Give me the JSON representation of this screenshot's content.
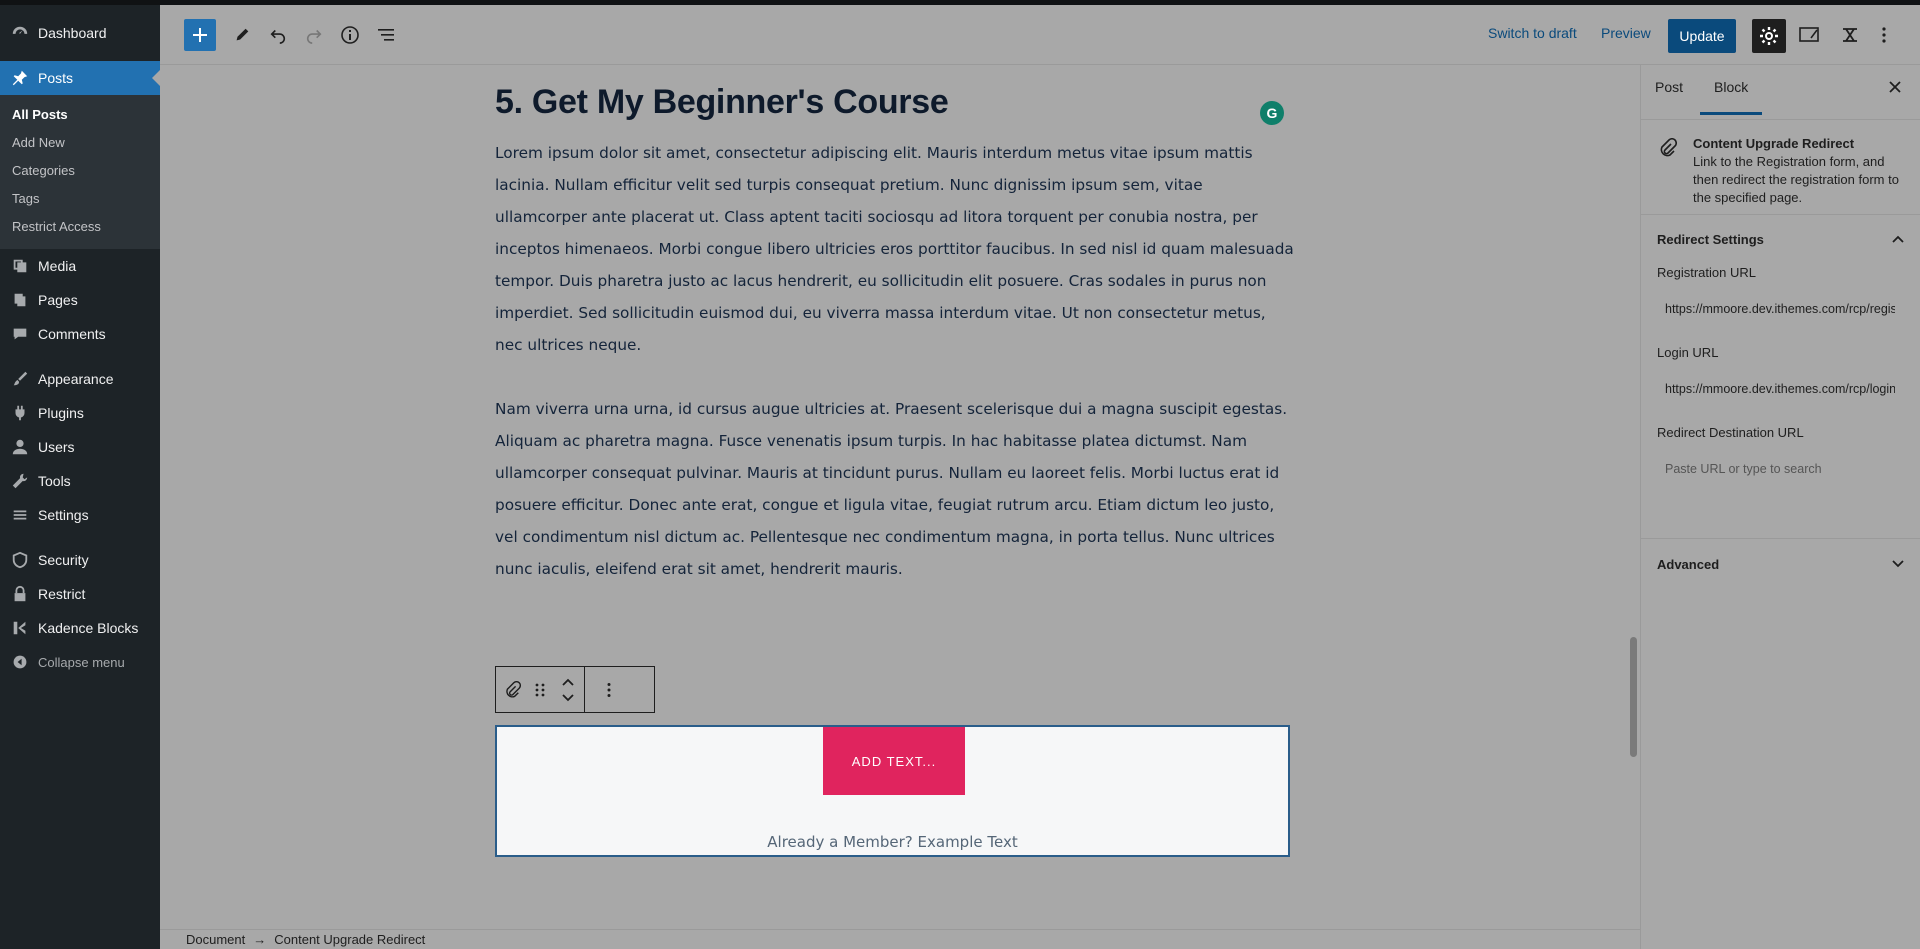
{
  "admin_menu": {
    "dashboard": "Dashboard",
    "posts": "Posts",
    "posts_sub": [
      "All Posts",
      "Add New",
      "Categories",
      "Tags",
      "Restrict Access"
    ],
    "media": "Media",
    "pages": "Pages",
    "comments": "Comments",
    "appearance": "Appearance",
    "plugins": "Plugins",
    "users": "Users",
    "tools": "Tools",
    "settings": "Settings",
    "security": "Security",
    "restrict": "Restrict",
    "kadence": "Kadence Blocks",
    "collapse": "Collapse menu"
  },
  "toolbar": {
    "switch_to_draft": "Switch to draft",
    "preview": "Preview",
    "update": "Update"
  },
  "content": {
    "heading": "5. Get My Beginner's Course",
    "paragraph1": "Lorem ipsum dolor sit amet, consectetur adipiscing elit. Mauris interdum metus vitae ipsum mattis lacinia. Nullam efficitur velit sed turpis consequat pretium. Nunc dignissim ipsum sem, vitae ullamcorper ante placerat ut. Class aptent taciti sociosqu ad litora torquent per conubia nostra, per inceptos himenaeos. Morbi congue libero ultricies eros porttitor faucibus. In sed nisl id quam malesuada tempor. Duis pharetra justo ac lacus hendrerit, eu sollicitudin elit posuere. Cras sodales in purus non imperdiet. Sed sollicitudin euismod dui, eu viverra massa interdum vitae. Ut non consectetur metus, nec ultrices neque.",
    "paragraph2": "Nam viverra urna urna, id cursus augue ultricies at. Praesent scelerisque dui a magna suscipit egestas. Aliquam ac pharetra magna. Fusce venenatis ipsum turpis. In hac habitasse platea dictumst. Nam ullamcorper consequat pulvinar. Mauris at tincidunt purus. Nullam eu laoreet felis. Morbi luctus erat id posuere efficitur. Donec ante erat, congue et ligula vitae, feugiat rutrum arcu. Etiam dictum leo justo, vel condimentum nisl dictum ac. Pellentesque nec condimentum magna, in porta tellus. Nunc ultrices nunc iaculis, eleifend erat sit amet, hendrerit mauris.",
    "grammarly": "G"
  },
  "block": {
    "button_text": "ADD TEXT...",
    "member_text": "Already a Member? Example Text"
  },
  "breadcrumb": {
    "document": "Document",
    "arrow": "→",
    "current": "Content Upgrade Redirect"
  },
  "sidebar": {
    "tab_post": "Post",
    "tab_block": "Block",
    "block_title": "Content Upgrade Redirect",
    "block_desc": "Link to the Registration form, and then redirect the registration form to the specified page.",
    "redirect_settings": "Redirect Settings",
    "registration_url_label": "Registration URL",
    "registration_url_value": "https://mmoore.dev.ithemes.com/rcp/register/",
    "login_url_label": "Login URL",
    "login_url_value": "https://mmoore.dev.ithemes.com/rcp/login/",
    "redirect_dest_label": "Redirect Destination URL",
    "redirect_dest_placeholder": "Paste URL or type to search",
    "advanced": "Advanced"
  },
  "colors": {
    "accent": "#2271b1",
    "update_button": "#0a4a7c",
    "cta_button": "#e0245e"
  }
}
